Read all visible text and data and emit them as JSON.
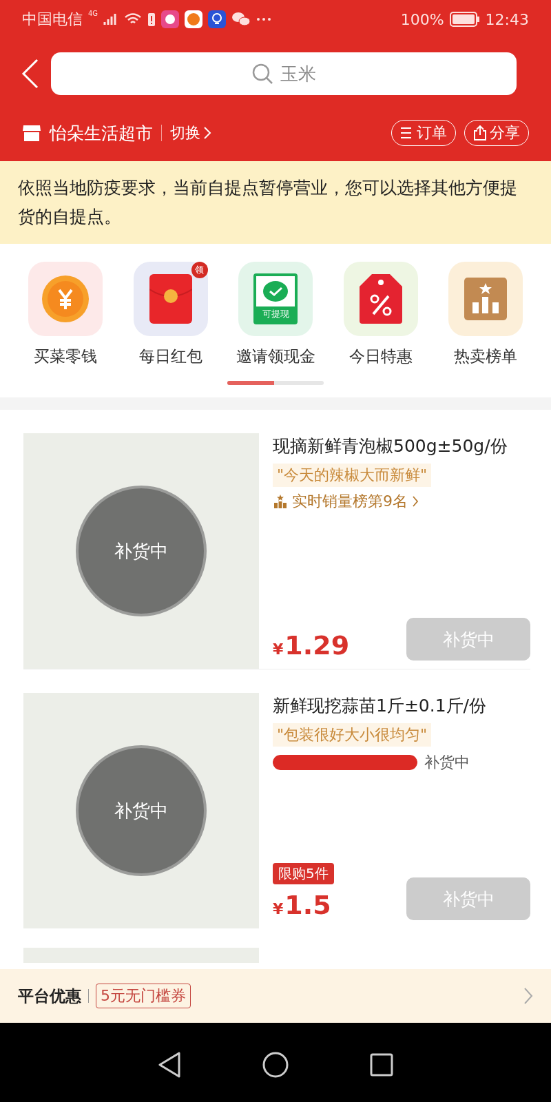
{
  "status_bar": {
    "carrier": "中国电信",
    "network": "4G",
    "battery": "100%",
    "time": "12:43"
  },
  "search": {
    "placeholder": "玉米"
  },
  "store": {
    "name": "怡朵生活超市",
    "switch": "切换",
    "actions": [
      {
        "kind": "orders",
        "label": "订单"
      },
      {
        "kind": "share",
        "label": "分享"
      }
    ]
  },
  "notice": "依照当地防疫要求，当前自提点暂停营业，您可以选择其他方便提货的自提点。",
  "shortcuts": [
    {
      "kind": "coin",
      "label": "买菜零钱"
    },
    {
      "kind": "redpacket",
      "label": "每日红包",
      "badge": "领"
    },
    {
      "kind": "cash",
      "label": "邀请领现金",
      "tag": "可提现"
    },
    {
      "kind": "discount",
      "label": "今日特惠"
    },
    {
      "kind": "ranking",
      "label": "热卖榜单"
    }
  ],
  "products": [
    {
      "title": "现摘新鲜青泡椒500g±50g/份",
      "quote": "\"今天的辣椒大而新鲜\"",
      "kind": "rank",
      "rank": "实时销量榜第9名",
      "overlay": "补货中",
      "price": "1.29",
      "currency": "¥",
      "button": "补货中",
      "disabled": true
    },
    {
      "title": "新鲜现挖蒜苗1斤±0.1斤/份",
      "quote": "\"包装很好大小很均匀\"",
      "kind": "progress",
      "level": 1,
      "progress_label": "补货中",
      "limit": "限购5件",
      "overlay": "补货中",
      "price": "1.5",
      "currency": "¥",
      "button": "补货中",
      "disabled": true
    }
  ],
  "coupon_bar": {
    "label": "平台优惠",
    "coupon": "5元无门槛券"
  }
}
